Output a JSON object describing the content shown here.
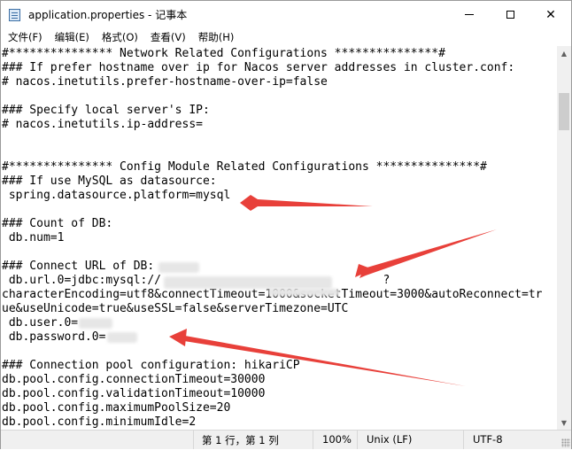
{
  "window": {
    "title": "application.properties - 记事本"
  },
  "menu": [
    "文件(F)",
    "编辑(E)",
    "格式(O)",
    "查看(V)",
    "帮助(H)"
  ],
  "lines": [
    "#*************** Network Related Configurations ***************#",
    "### If prefer hostname over ip for Nacos server addresses in cluster.conf:",
    "# nacos.inetutils.prefer-hostname-over-ip=false",
    "",
    "### Specify local server's IP:",
    "# nacos.inetutils.ip-address=",
    "",
    "",
    "#*************** Config Module Related Configurations ***************#",
    "### If use MySQL as datasource:",
    " spring.datasource.platform=mysql",
    "",
    "### Count of DB:",
    " db.num=1",
    "",
    "### Connect URL of DB:",
    " db.url.0=jdbc:mysql://                                ?",
    "characterEncoding=utf8&connectTimeout=1000&socketTimeout=3000&autoReconnect=tr",
    "ue&useUnicode=true&useSSL=false&serverTimezone=UTC",
    " db.user.0=",
    " db.password.0=",
    "",
    "### Connection pool configuration: hikariCP",
    "db.pool.config.connectionTimeout=30000",
    "db.pool.config.validationTimeout=10000",
    "db.pool.config.maximumPoolSize=20",
    "db.pool.config.minimumIdle=2"
  ],
  "status": {
    "position": "第 1 行，第 1 列",
    "zoom": "100%",
    "line_ending": "Unix (LF)",
    "encoding": "UTF-8"
  },
  "colors": {
    "arrow": "#e8403a",
    "accent": "#3b6ea5"
  }
}
